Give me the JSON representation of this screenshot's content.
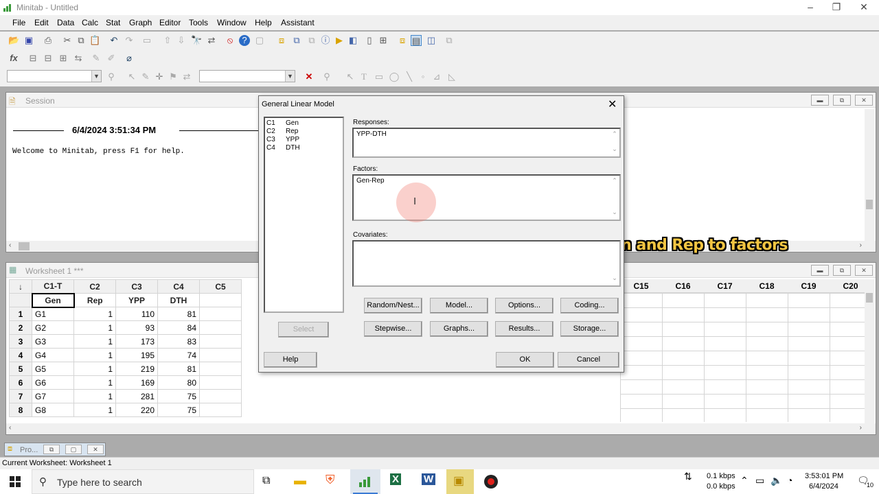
{
  "app": {
    "title": "Minitab - Untitled"
  },
  "menu": [
    "File",
    "Edit",
    "Data",
    "Calc",
    "Stat",
    "Graph",
    "Editor",
    "Tools",
    "Window",
    "Help",
    "Assistant"
  ],
  "session": {
    "title": "Session",
    "timestamp": "6/4/2024 3:51:34 PM",
    "welcome": "Welcome to Minitab, press F1 for help."
  },
  "worksheet": {
    "title": "Worksheet 1 ***",
    "col_ids": [
      "C1-T",
      "C2",
      "C3",
      "C4",
      "C5"
    ],
    "col_names": [
      "Gen",
      "Rep",
      "YPP",
      "DTH",
      ""
    ],
    "right_col_ids": [
      "C15",
      "C16",
      "C17",
      "C18",
      "C19",
      "C20"
    ],
    "rows": [
      {
        "n": "1",
        "gen": "G1",
        "rep": "1",
        "ypp": "110",
        "dth": "81"
      },
      {
        "n": "2",
        "gen": "G2",
        "rep": "1",
        "ypp": "93",
        "dth": "84"
      },
      {
        "n": "3",
        "gen": "G3",
        "rep": "1",
        "ypp": "173",
        "dth": "83"
      },
      {
        "n": "4",
        "gen": "G4",
        "rep": "1",
        "ypp": "195",
        "dth": "74"
      },
      {
        "n": "5",
        "gen": "G5",
        "rep": "1",
        "ypp": "219",
        "dth": "81"
      },
      {
        "n": "6",
        "gen": "G6",
        "rep": "1",
        "ypp": "169",
        "dth": "80"
      },
      {
        "n": "7",
        "gen": "G7",
        "rep": "1",
        "ypp": "281",
        "dth": "75"
      },
      {
        "n": "8",
        "gen": "G8",
        "rep": "1",
        "ypp": "220",
        "dth": "75"
      }
    ]
  },
  "dialog": {
    "title": "General Linear Model",
    "variables": [
      {
        "col": "C1",
        "name": "Gen"
      },
      {
        "col": "C2",
        "name": "Rep"
      },
      {
        "col": "C3",
        "name": "YPP"
      },
      {
        "col": "C4",
        "name": "DTH"
      }
    ],
    "responses_label": "Responses:",
    "responses_value": "YPP-DTH",
    "factors_label": "Factors:",
    "factors_value": "Gen-Rep",
    "covariates_label": "Covariates:",
    "covariates_value": "",
    "buttons": {
      "random": "Random/Nest...",
      "model": "Model...",
      "options": "Options...",
      "coding": "Coding...",
      "stepwise": "Stepwise...",
      "graphs": "Graphs...",
      "results": "Results...",
      "storage": "Storage...",
      "select": "Select",
      "help": "Help",
      "ok": "OK",
      "cancel": "Cancel"
    }
  },
  "overlay": "Add Gen and Rep to factors",
  "project_tab": "Pro...",
  "status": "Current Worksheet: Worksheet 1",
  "taskbar": {
    "search_placeholder": "Type here to search",
    "net_up": "0.1 kbps",
    "net_down": "0.0 kbps",
    "time": "3:53:01 PM",
    "date": "6/4/2024",
    "notif": "10"
  }
}
